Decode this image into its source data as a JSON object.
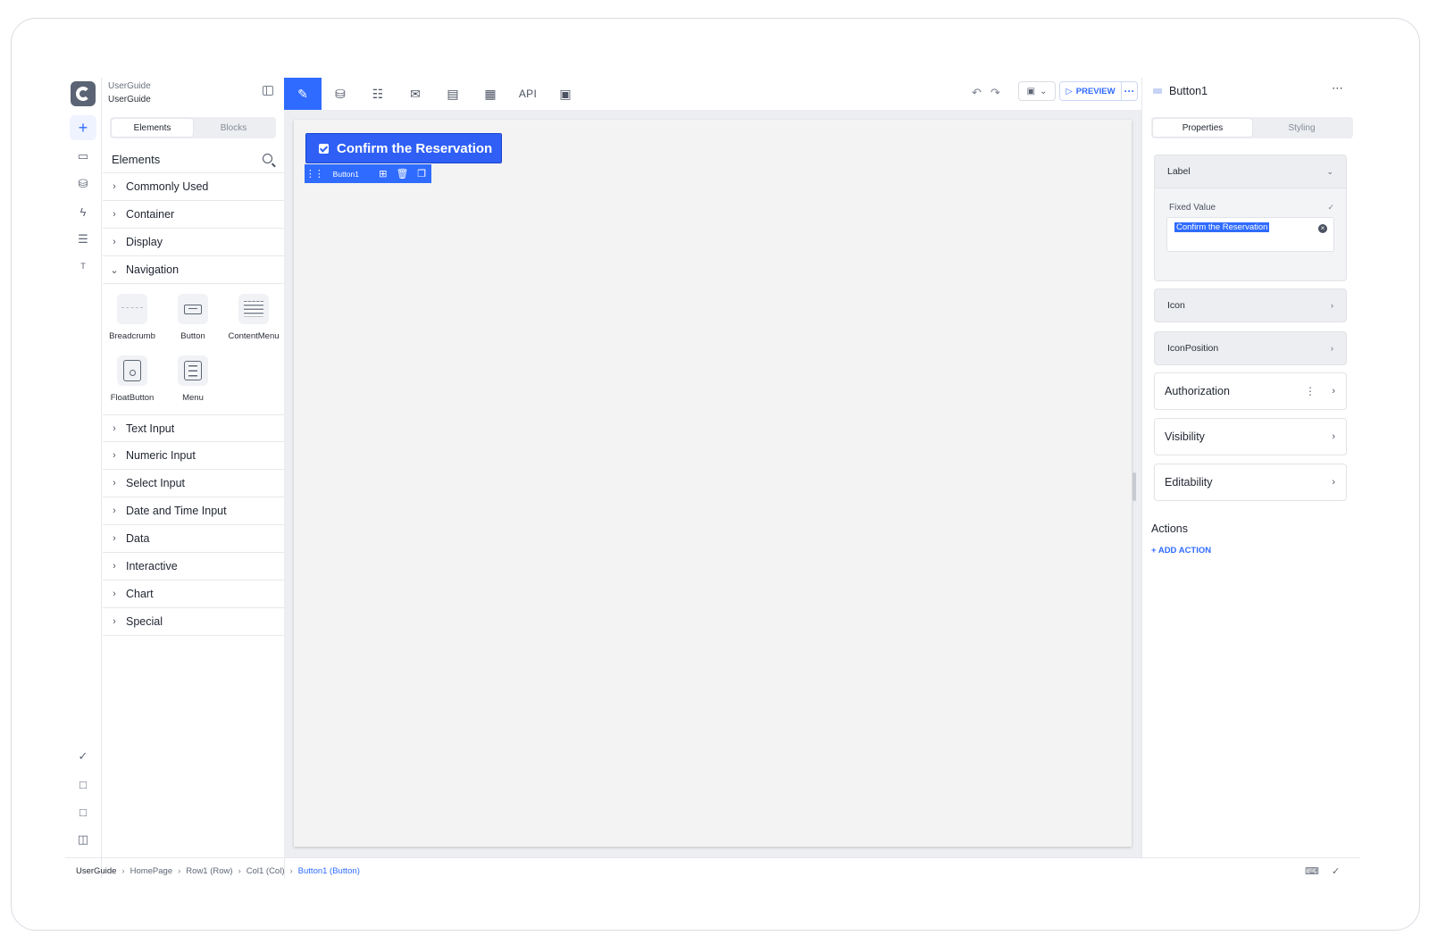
{
  "app": {
    "name_line1": "UserGuide",
    "name_line2": "UserGuide"
  },
  "left_panel": {
    "tabs": [
      "Elements",
      "Blocks"
    ],
    "active_tab": "Elements",
    "header": "Elements",
    "categories_top": [
      "Commonly Used",
      "Container",
      "Display"
    ],
    "expanded_category": "Navigation",
    "navigation_items": [
      "Breadcrumb",
      "Button",
      "ContentMenu",
      "FloatButton",
      "Menu"
    ],
    "categories_bottom": [
      "Text Input",
      "Numeric Input",
      "Select Input",
      "Date and Time Input",
      "Data",
      "Interactive",
      "Chart",
      "Special"
    ]
  },
  "toolbar": {
    "api_label": "API",
    "preview_label": "PREVIEW",
    "more_label": "···"
  },
  "canvas": {
    "button_label": "Confirm the Reservation",
    "selected_name": "Button1"
  },
  "properties": {
    "title": "Button1",
    "tabs": [
      "Properties",
      "Styling"
    ],
    "active_tab": "Properties",
    "label_section": "Label",
    "fixed_value_label": "Fixed Value",
    "fixed_value": "Confirm the Reservation",
    "icon_section": "Icon",
    "icon_position_section": "IconPosition",
    "authorization_section": "Authorization",
    "visibility_section": "Visibility",
    "editability_section": "Editability",
    "actions_title": "Actions",
    "add_action": "+ ADD ACTION"
  },
  "breadcrumb": [
    "UserGuide",
    "HomePage",
    "Row1 (Row)",
    "Col1 (Col)",
    "Button1 (Button)"
  ],
  "colors": {
    "accent": "#2f6bff",
    "button": "#2f5ff5"
  }
}
